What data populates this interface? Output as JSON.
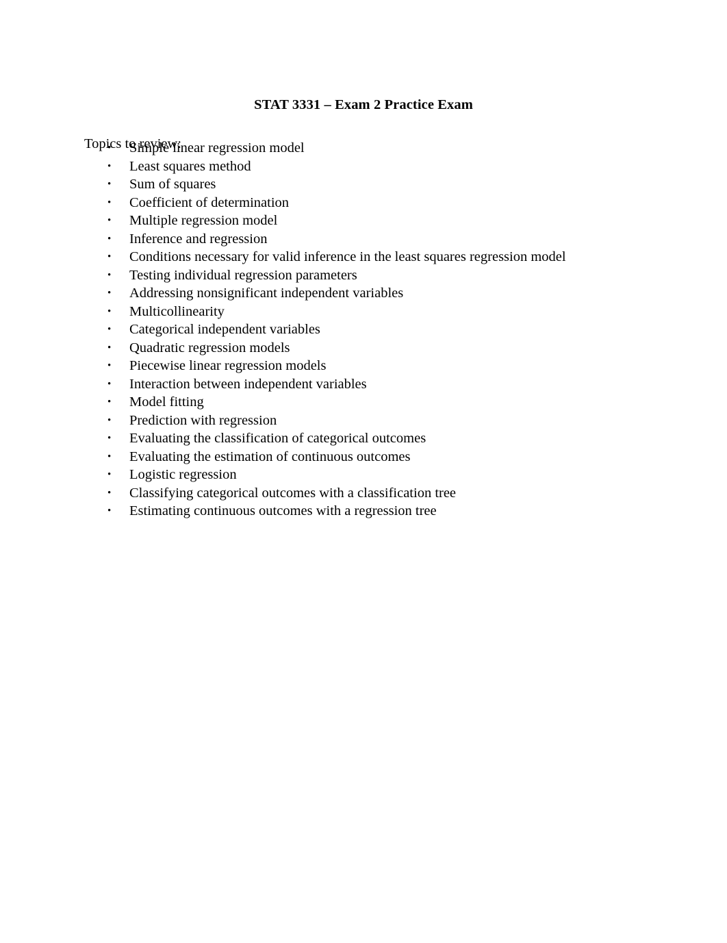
{
  "document": {
    "title": "STAT 3331 – Exam 2 Practice Exam",
    "intro": "Topics to review:",
    "bullet_glyph": "•",
    "text_color": "#000000",
    "background_color": "#ffffff",
    "topics": [
      {
        "label": "Simple linear regression model"
      },
      {
        "label": "Least squares method"
      },
      {
        "label": "Sum of squares"
      },
      {
        "label": "Coefficient of determination"
      },
      {
        "label": "Multiple regression model"
      },
      {
        "label": "Inference and regression"
      },
      {
        "label": "Conditions necessary for valid inference in the least squares regression model"
      },
      {
        "label": "Testing individual regression parameters"
      },
      {
        "label": "Addressing nonsignificant independent variables"
      },
      {
        "label": "Multicollinearity"
      },
      {
        "label": "Categorical independent variables"
      },
      {
        "label": "Quadratic regression models"
      },
      {
        "label": "Piecewise linear regression models"
      },
      {
        "label": "Interaction between independent variables"
      },
      {
        "label": "Model fitting"
      },
      {
        "label": "Prediction with regression"
      },
      {
        "label": "Evaluating the classification of categorical outcomes"
      },
      {
        "label": "Evaluating the estimation of continuous outcomes"
      },
      {
        "label": "Logistic regression"
      },
      {
        "label": "Classifying categorical outcomes with a classification tree"
      },
      {
        "label": "Estimating continuous outcomes with a regression tree"
      }
    ]
  }
}
